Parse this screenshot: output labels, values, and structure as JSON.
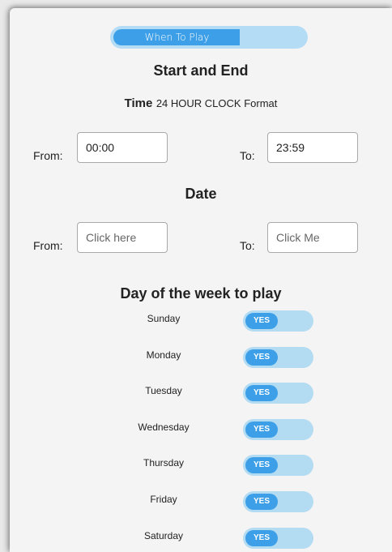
{
  "progress": {
    "label": "When To Play",
    "fraction": 0.65
  },
  "section_start_end": {
    "title": "Start and End"
  },
  "time": {
    "bold_label": "Time",
    "format_note": "24 HOUR CLOCK Format",
    "from_label": "From:",
    "from_value": "00:00",
    "to_label": "To:",
    "to_value": "23:59"
  },
  "date": {
    "title": "Date",
    "from_label": "From:",
    "from_placeholder": "Click here",
    "to_label": "To:",
    "to_placeholder": "Click Me"
  },
  "days": {
    "title": "Day of the week to play",
    "toggle_text": "YES",
    "items": [
      {
        "label": "Sunday",
        "enabled": true
      },
      {
        "label": "Monday",
        "enabled": true
      },
      {
        "label": "Tuesday",
        "enabled": true
      },
      {
        "label": "Wednesday",
        "enabled": true
      },
      {
        "label": "Thursday",
        "enabled": true
      },
      {
        "label": "Friday",
        "enabled": true
      },
      {
        "label": "Saturday",
        "enabled": true
      }
    ]
  },
  "colors": {
    "accent": "#3d9fe8",
    "accent_light": "#b3dcf3",
    "background": "#f4f4f4"
  }
}
